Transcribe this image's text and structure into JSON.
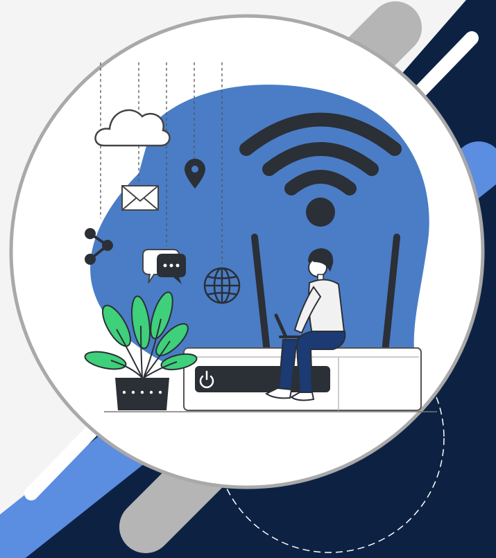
{
  "scene": {
    "title": "",
    "colors": {
      "light_bg": "#f4f4f5",
      "navy": "#0d2243",
      "accent_blue": "#5b8de0",
      "blob_blue": "#4a7dc6",
      "gray_stripe": "#b5b5b5",
      "white_stripe": "#ffffff",
      "ink": "#2b2f36",
      "plant_green": "#3ed07a",
      "shirt": "#f1f1f1",
      "jeans": "#1c3a73"
    },
    "icons": [
      "cloud-icon",
      "location-pin-icon",
      "envelope-icon",
      "share-icon",
      "chat-bubbles-icon",
      "globe-icon",
      "power-icon",
      "wifi-icon"
    ]
  }
}
